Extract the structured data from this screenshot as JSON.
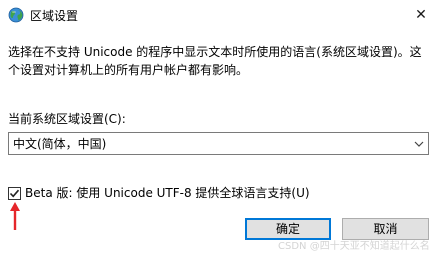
{
  "window": {
    "title": "区域设置",
    "close_glyph": "✕",
    "title_icon": "globe-icon"
  },
  "description": {
    "line1": "选择在不支持 Unicode 的程序中显示文本时所使用的语言(系统区域设置)。这",
    "line2": "个设置对计算机上的所有用户帐户都有影响。"
  },
  "locale": {
    "label": "当前系统区域设置(C):",
    "selected_value": "中文(简体，中国)"
  },
  "beta_option": {
    "label": "Beta 版: 使用 Unicode UTF-8 提供全球语言支持(U)",
    "checked": true
  },
  "buttons": {
    "ok_label": "确定",
    "cancel_label": "取消"
  },
  "annotation": {
    "arrow_color": "#e5262a"
  },
  "watermark": {
    "text": "CSDN @四十天亚不知道起什么名"
  },
  "colors": {
    "accent": "#0078d7",
    "button_face": "#e1e1e1"
  }
}
